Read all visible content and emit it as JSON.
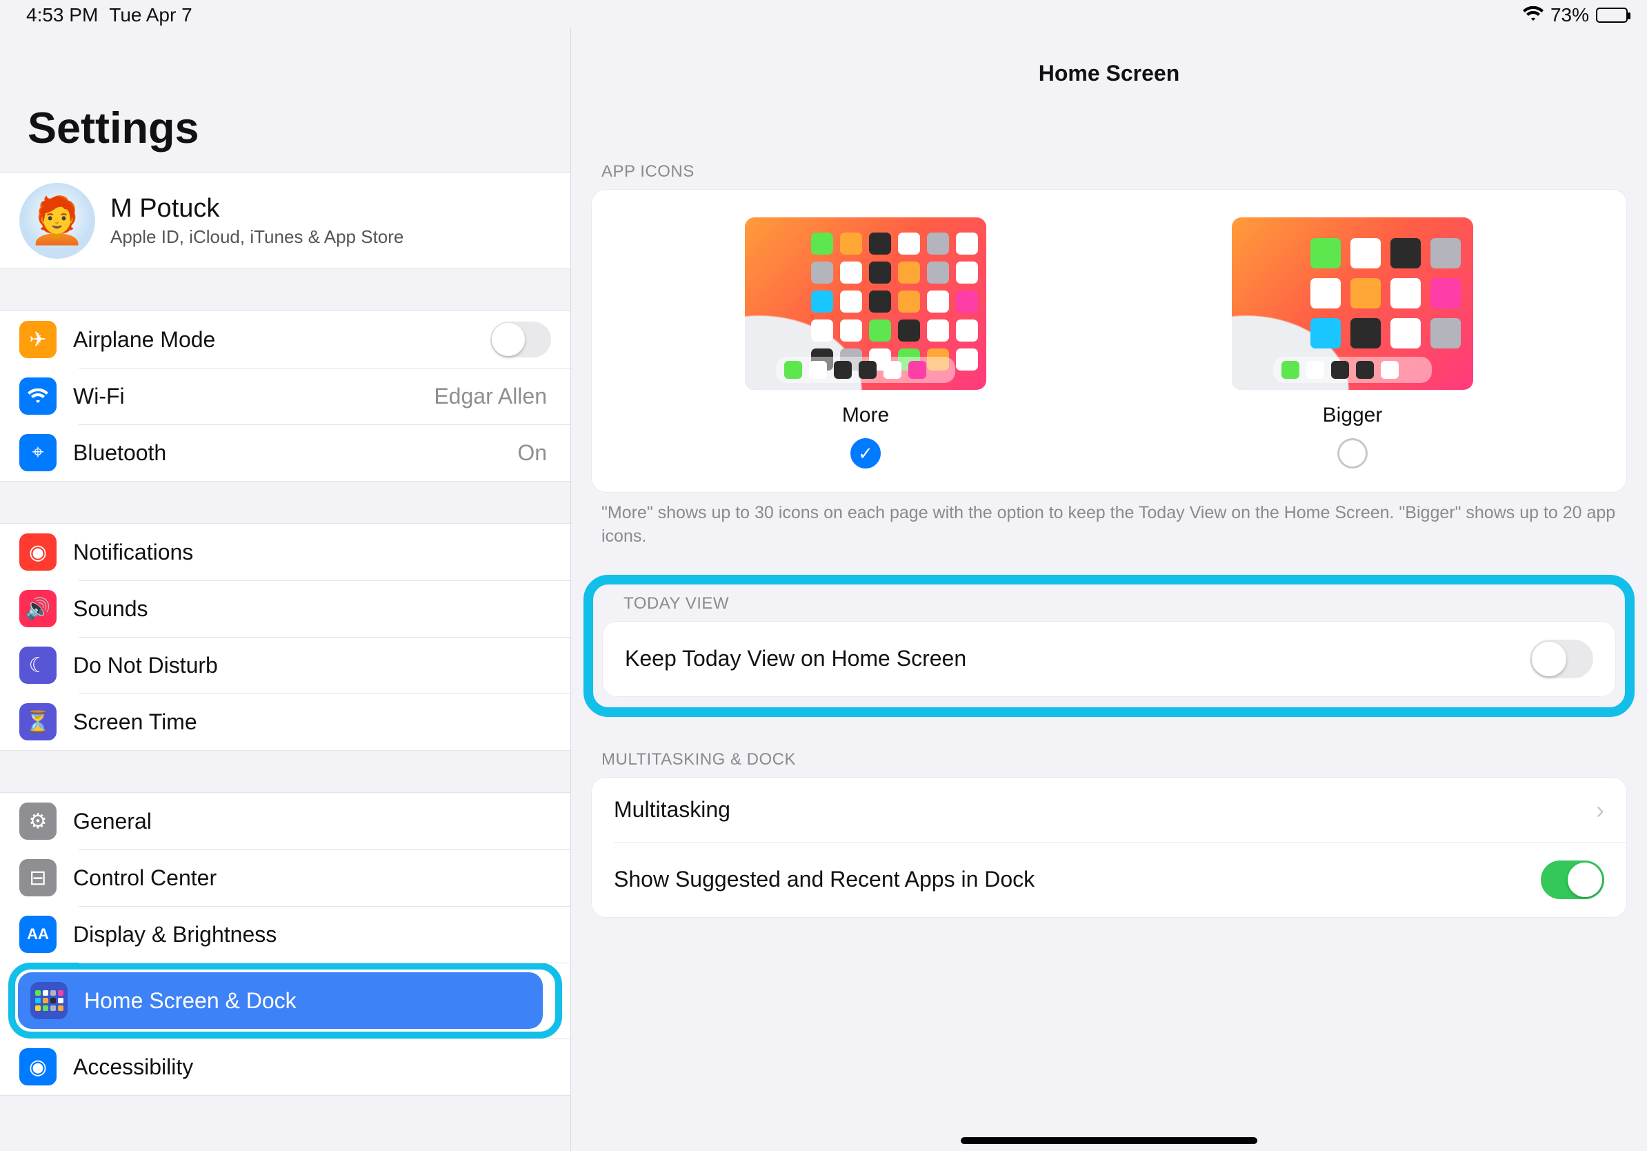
{
  "status": {
    "time": "4:53 PM",
    "date": "Tue Apr 7",
    "battery_pct": "73%",
    "battery_fill": 73
  },
  "sidebar": {
    "title": "Settings",
    "account": {
      "name": "M Potuck",
      "subtitle": "Apple ID, iCloud, iTunes & App Store"
    },
    "group1": {
      "airplane": "Airplane Mode",
      "wifi": "Wi-Fi",
      "wifi_net": "Edgar Allen",
      "bt": "Bluetooth",
      "bt_val": "On"
    },
    "group2": {
      "notif": "Notifications",
      "sounds": "Sounds",
      "dnd": "Do Not Disturb",
      "screentime": "Screen Time"
    },
    "group3": {
      "general": "General",
      "cc": "Control Center",
      "display": "Display & Brightness",
      "home": "Home Screen & Dock",
      "access": "Accessibility"
    }
  },
  "detail": {
    "title": "Home Screen",
    "app_icons_header": "APP ICONS",
    "opt_more": "More",
    "opt_bigger": "Bigger",
    "selected": "more",
    "footer": "\"More\" shows up to 30 icons on each page with the option to keep the Today View on the Home Screen. \"Bigger\" shows up to 20 app icons.",
    "today_header": "TODAY VIEW",
    "today_row": "Keep Today View on Home Screen",
    "today_on": false,
    "multi_header": "MULTITASKING & DOCK",
    "multi_row": "Multitasking",
    "dock_row": "Show Suggested and Recent Apps in Dock",
    "dock_on": true
  }
}
